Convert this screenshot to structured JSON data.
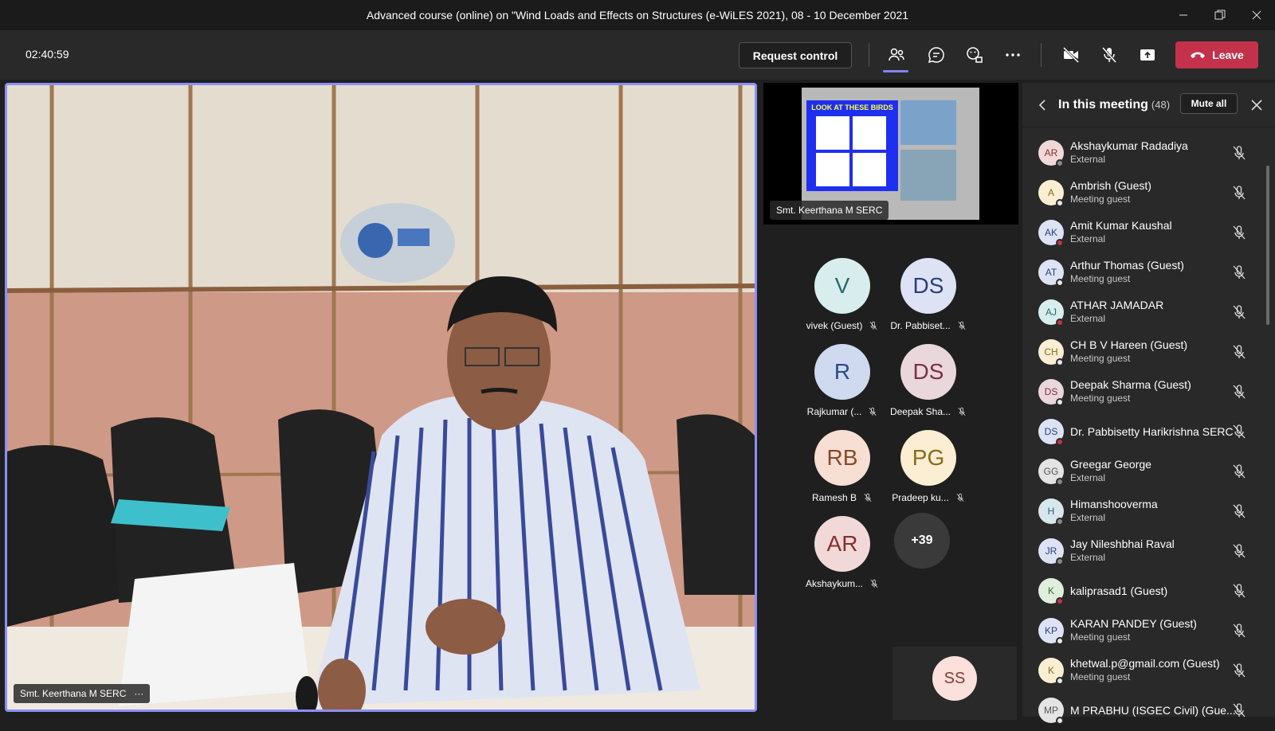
{
  "window": {
    "title": "Advanced course (online) on \"Wind Loads and Effects on Structures (e-WiLES 2021), 08 - 10 December 2021",
    "min_icon": "minimize-icon",
    "restore_icon": "restore-icon",
    "close_icon": "close-icon"
  },
  "toolbar": {
    "timer": "02:40:59",
    "request_control": "Request control",
    "leave": "Leave",
    "icons": [
      "people-icon",
      "chat-icon",
      "reactions-icon",
      "more-icon",
      "camera-off-icon",
      "mic-off-icon",
      "share-icon",
      "phone-icon"
    ]
  },
  "colors": {
    "accent": "#7f85f5",
    "leave": "#c4314b",
    "panel": "#292929",
    "background": "#1f1f1f",
    "status_green": "#92c353",
    "status_red": "#c4314b",
    "status_gray": "#8a8a8a"
  },
  "main_video": {
    "label": "Smt. Keerthana M SERC",
    "more": "···"
  },
  "gallery": {
    "share_label": "Smt. Keerthana M SERC",
    "slide_title": "LOOK AT THESE BIRDS",
    "tiles": [
      {
        "initials": "V",
        "name": "vivek (Guest)",
        "bg": "#d8eeee",
        "fg": "#2a6a6a"
      },
      {
        "initials": "DS",
        "name": "Dr. Pabbiset...",
        "bg": "#dde3f5",
        "fg": "#2a3f7a"
      },
      {
        "initials": "R",
        "name": "Rajkumar (...",
        "bg": "#cfdaf0",
        "fg": "#2a4a8a"
      },
      {
        "initials": "DS",
        "name": "Deepak Sha...",
        "bg": "#ead7dc",
        "fg": "#7a2f45"
      },
      {
        "initials": "RB",
        "name": "Ramesh B",
        "bg": "#f7dfd3",
        "fg": "#8a4a2a"
      },
      {
        "initials": "PG",
        "name": "Pradeep ku...",
        "bg": "#fbeed2",
        "fg": "#8a6a1a"
      },
      {
        "initials": "AR",
        "name": "Akshaykum...",
        "bg": "#f2d9d9",
        "fg": "#8a2f2f"
      }
    ],
    "more_count": "+39",
    "ss_tile": {
      "initials": "SS",
      "bg": "#fbe0dc",
      "fg": "#8a3a2f"
    }
  },
  "panel": {
    "title": "In this meeting",
    "count": "(48)",
    "mute_all": "Mute all",
    "participants": [
      {
        "initials": "AR",
        "name": "Akshaykumar Radadiya",
        "sub": "External",
        "bg": "#f2d9d9",
        "fg": "#8a2f2f",
        "status": "#8a8a8a"
      },
      {
        "initials": "A",
        "name": "Ambrish (Guest)",
        "sub": "Meeting guest",
        "bg": "#fbeed2",
        "fg": "#8a6a1a",
        "status": "#e8e8e8"
      },
      {
        "initials": "AK",
        "name": "Amit Kumar Kaushal",
        "sub": "External",
        "bg": "#dde3f5",
        "fg": "#2a3f7a",
        "status": "#c4314b"
      },
      {
        "initials": "AT",
        "name": "Arthur Thomas (Guest)",
        "sub": "Meeting guest",
        "bg": "#dde3f5",
        "fg": "#2a3f7a",
        "status": "#e8e8e8"
      },
      {
        "initials": "AJ",
        "name": "ATHAR JAMADAR",
        "sub": "External",
        "bg": "#d8eeee",
        "fg": "#2a6a6a",
        "status": "#c4314b"
      },
      {
        "initials": "CH",
        "name": "CH B V Hareen (Guest)",
        "sub": "Meeting guest",
        "bg": "#fbeed2",
        "fg": "#8a6a1a",
        "status": "#e8e8e8"
      },
      {
        "initials": "DS",
        "name": "Deepak Sharma (Guest)",
        "sub": "Meeting guest",
        "bg": "#ead7dc",
        "fg": "#7a2f45",
        "status": "#e8e8e8"
      },
      {
        "initials": "DS",
        "name": "Dr. Pabbisetty Harikrishna SERC",
        "sub": "",
        "bg": "#dde3f5",
        "fg": "#2a3f7a",
        "status": "#c4314b"
      },
      {
        "initials": "GG",
        "name": "Greegar George",
        "sub": "External",
        "bg": "#e4e4e4",
        "fg": "#555555",
        "status": "#8a8a8a"
      },
      {
        "initials": "H",
        "name": "Himanshooverma",
        "sub": "External",
        "bg": "#d8e6ee",
        "fg": "#2a5a7a",
        "status": "#8a8a8a"
      },
      {
        "initials": "JR",
        "name": "Jay Nileshbhai Raval",
        "sub": "External",
        "bg": "#dde3f5",
        "fg": "#2a3f7a",
        "status": "#8a8a8a"
      },
      {
        "initials": "K",
        "name": "kaliprasad1 (Guest)",
        "sub": "",
        "bg": "#dfeedd",
        "fg": "#3a6a2a",
        "status": "#c4314b"
      },
      {
        "initials": "KP",
        "name": "KARAN PANDEY (Guest)",
        "sub": "Meeting guest",
        "bg": "#dde3f5",
        "fg": "#2a3f7a",
        "status": "#e8e8e8"
      },
      {
        "initials": "K",
        "name": "khetwal.p@gmail.com (Guest)",
        "sub": "Meeting guest",
        "bg": "#fbeed2",
        "fg": "#8a6a1a",
        "status": "#e8e8e8"
      },
      {
        "initials": "MP",
        "name": "M PRABHU (ISGEC Civil) (Gue...",
        "sub": "",
        "bg": "#e4e4e4",
        "fg": "#555555",
        "status": "#e8e8e8"
      }
    ]
  }
}
